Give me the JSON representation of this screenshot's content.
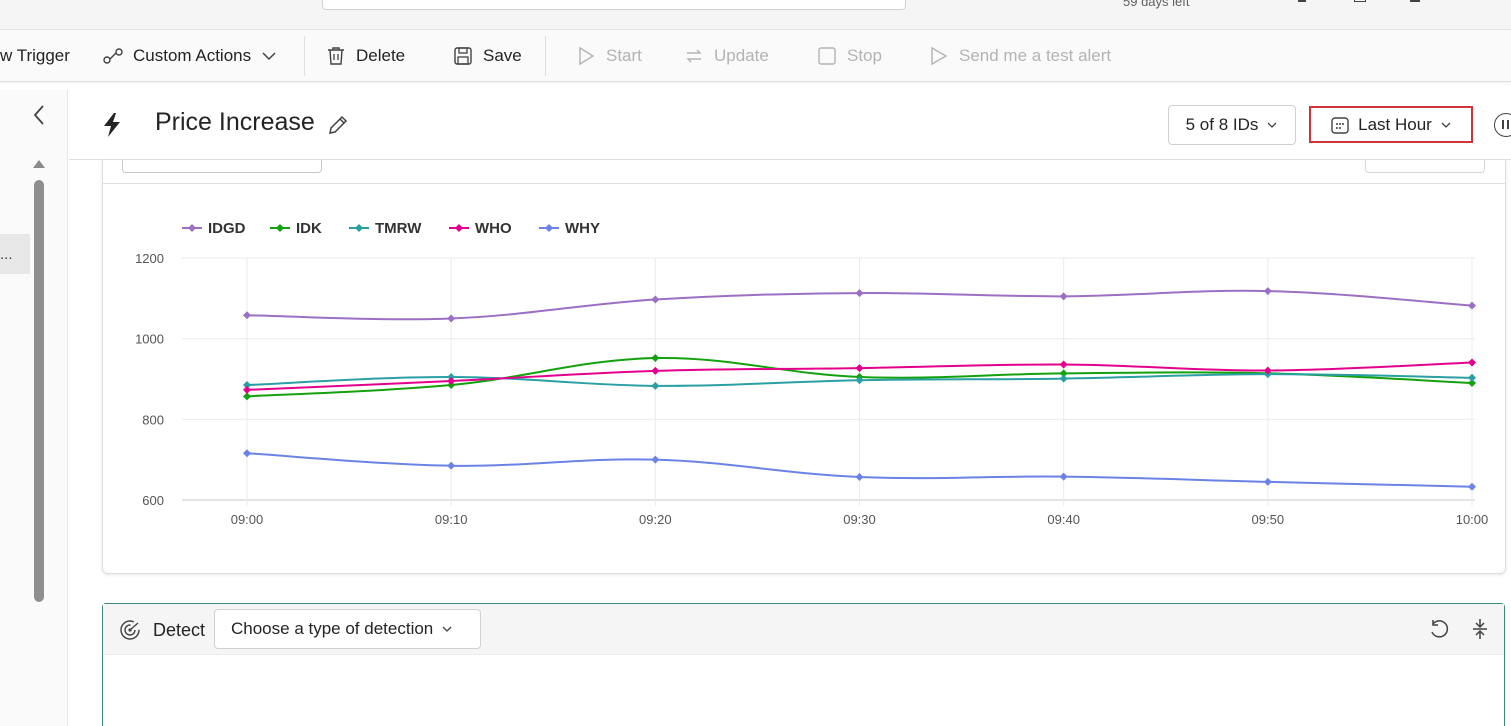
{
  "topbar": {
    "trial_text": "59 days left"
  },
  "toolbar": {
    "new_trigger_label": "w Trigger",
    "custom_actions_label": "Custom Actions",
    "delete_label": "Delete",
    "save_label": "Save",
    "start_label": "Start",
    "update_label": "Update",
    "stop_label": "Stop",
    "send_test_label": "Send me a test alert"
  },
  "sidebar": {
    "selected_item_text": "..."
  },
  "header": {
    "title": "Price Increase",
    "ids_filter": "5 of 8 IDs",
    "time_range": "Last Hour"
  },
  "colors": {
    "IDGD": "#9b6fc4",
    "IDK": "#13a10e",
    "TMRW": "#2aa0a4",
    "WHO": "#e3008c",
    "WHY": "#6b83e6",
    "highlight": "#d13438"
  },
  "chart_data": {
    "type": "line",
    "x": [
      "09:00",
      "09:10",
      "09:20",
      "09:30",
      "09:40",
      "09:50",
      "10:00"
    ],
    "ylim": [
      600,
      1200
    ],
    "yticks": [
      "1200",
      "1000",
      "800",
      "600"
    ],
    "legend_position": "top-left",
    "grid": true,
    "series": [
      {
        "name": "IDGD",
        "values": [
          1058,
          1050,
          1097,
          1113,
          1105,
          1118,
          1082
        ]
      },
      {
        "name": "IDK",
        "values": [
          857,
          885,
          952,
          905,
          914,
          914,
          890
        ]
      },
      {
        "name": "TMRW",
        "values": [
          885,
          905,
          883,
          897,
          901,
          912,
          903
        ]
      },
      {
        "name": "WHO",
        "values": [
          873,
          895,
          920,
          927,
          936,
          921,
          941
        ]
      },
      {
        "name": "WHY",
        "values": [
          716,
          685,
          700,
          657,
          658,
          645,
          633
        ]
      }
    ]
  },
  "detect": {
    "label": "Detect",
    "select_placeholder": "Choose a type of detection"
  }
}
